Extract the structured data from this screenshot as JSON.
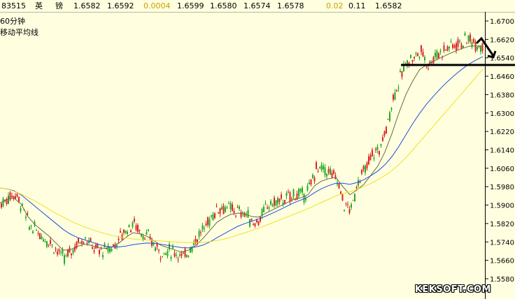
{
  "topbar": {
    "code": "83515",
    "name_1": "英",
    "name_2": "镑",
    "price_1": "1.6582",
    "price_2": "1.6592",
    "change": "0.0004",
    "price_3": "1.6599",
    "price_4": "1.6580",
    "price_5": "1.6574",
    "price_6": "1.6578",
    "pct": "0.02",
    "vol": "0.11",
    "last": "1.6582"
  },
  "labels": {
    "period": "60分钟",
    "indicator": "移动平均线",
    "watermark": "KEKSOFT.COM"
  },
  "colors": {
    "background": "#ffffe0",
    "up_candle": "#22aa22",
    "down_candle": "#dd2222",
    "ma_short": "#6b6b3a",
    "ma_mid": "#1f4fe0",
    "ma_long": "#f0e020",
    "annotation": "#000000"
  },
  "chart_data": {
    "type": "line",
    "y_ticks": [
      "1.6700",
      "1.6620",
      "1.6540",
      "1.6460",
      "1.6380",
      "1.6300",
      "1.6220",
      "1.6140",
      "1.6060",
      "1.5980",
      "1.5900",
      "1.5820",
      "1.5740",
      "1.5660",
      "1.5580"
    ],
    "ylim": [
      1.5545,
      1.6725
    ],
    "x": [
      0,
      10,
      20,
      30,
      40,
      50,
      60,
      70,
      80,
      90,
      100,
      110,
      120,
      130,
      140,
      150,
      160,
      170,
      180,
      190,
      200,
      210,
      220,
      230,
      240,
      250,
      260,
      270,
      280,
      290,
      300,
      310,
      320,
      330,
      340,
      350,
      360,
      370,
      380,
      390,
      400,
      410,
      420,
      430,
      440,
      450,
      460,
      470,
      480,
      490,
      500,
      510,
      520,
      530,
      540,
      550,
      560,
      570,
      580,
      590,
      600,
      610,
      620,
      630,
      640,
      650,
      660,
      670,
      680,
      690
    ],
    "series": [
      {
        "values": [
          1.5905,
          1.5935,
          1.595,
          1.589,
          1.581,
          1.579,
          1.576,
          1.574,
          1.57,
          1.5665,
          1.57,
          1.574,
          1.576,
          1.572,
          1.57,
          1.5705,
          1.572,
          1.5765,
          1.58,
          1.582,
          1.578,
          1.576,
          1.572,
          1.569,
          1.57,
          1.5695,
          1.567,
          1.5715,
          1.576,
          1.58,
          1.585,
          1.589,
          1.589,
          1.588,
          1.587,
          1.586,
          1.582,
          1.584,
          1.59,
          1.591,
          1.592,
          1.593,
          1.595,
          1.594,
          1.597,
          1.606,
          1.6055,
          1.604,
          1.601,
          1.59,
          1.588,
          1.601,
          1.605,
          1.612,
          1.614,
          1.623,
          1.637,
          1.645,
          1.653,
          1.654,
          1.657,
          1.651,
          1.655,
          1.657,
          1.659,
          1.66,
          1.661,
          1.662,
          1.66,
          1.659
        ]
      },
      {
        "values": [
          1.591,
          1.5925,
          1.593,
          1.5905,
          1.585,
          1.5815,
          1.579,
          1.5765,
          1.5735,
          1.5705,
          1.5705,
          1.572,
          1.573,
          1.5725,
          1.5715,
          1.5712,
          1.5718,
          1.5735,
          1.576,
          1.578,
          1.5775,
          1.5765,
          1.5745,
          1.5725,
          1.5715,
          1.5705,
          1.5695,
          1.5705,
          1.5725,
          1.5755,
          1.579,
          1.5825,
          1.5845,
          1.586,
          1.5865,
          1.5862,
          1.585,
          1.5848,
          1.5865,
          1.588,
          1.5895,
          1.591,
          1.5925,
          1.5932,
          1.5945,
          1.5985,
          1.6005,
          1.6015,
          1.602,
          1.598,
          1.5945,
          1.5965,
          1.599,
          1.603,
          1.607,
          1.613,
          1.621,
          1.63,
          1.638,
          1.644,
          1.649,
          1.651,
          1.6525,
          1.654,
          1.6555,
          1.6568,
          1.658,
          1.659,
          1.6592,
          1.659
        ]
      },
      {
        "values": [
          1.5975,
          1.597,
          1.5962,
          1.5945,
          1.592,
          1.5895,
          1.587,
          1.5845,
          1.582,
          1.5795,
          1.5775,
          1.576,
          1.575,
          1.574,
          1.573,
          1.5722,
          1.5718,
          1.5718,
          1.5722,
          1.5728,
          1.5732,
          1.5735,
          1.5734,
          1.573,
          1.5725,
          1.572,
          1.5715,
          1.5714,
          1.5718,
          1.5726,
          1.574,
          1.5758,
          1.5775,
          1.5792,
          1.5808,
          1.582,
          1.583,
          1.584,
          1.5852,
          1.5866,
          1.588,
          1.5895,
          1.591,
          1.5922,
          1.5935,
          1.5955,
          1.5972,
          1.5985,
          1.5995,
          1.5995,
          1.599,
          1.5998,
          1.601,
          1.6028,
          1.6048,
          1.6075,
          1.611,
          1.6155,
          1.6205,
          1.6255,
          1.63,
          1.634,
          1.6375,
          1.6408,
          1.6438,
          1.6465,
          1.649,
          1.6512,
          1.653,
          1.6545
        ]
      },
      {
        "values": [
          1.5975,
          1.597,
          1.596,
          1.5948,
          1.5933,
          1.5918,
          1.59,
          1.5882,
          1.5864,
          1.5848,
          1.5832,
          1.5818,
          1.5806,
          1.5795,
          1.5785,
          1.5776,
          1.5768,
          1.5762,
          1.5757,
          1.5753,
          1.575,
          1.5748,
          1.5746,
          1.5744,
          1.5742,
          1.574,
          1.5738,
          1.5737,
          1.5737,
          1.5738,
          1.5741,
          1.5746,
          1.5752,
          1.576,
          1.577,
          1.578,
          1.579,
          1.58,
          1.5812,
          1.5824,
          1.5836,
          1.5848,
          1.586,
          1.5872,
          1.5884,
          1.5898,
          1.5912,
          1.5926,
          1.594,
          1.595,
          1.5958,
          1.5968,
          1.598,
          1.5994,
          1.601,
          1.6028,
          1.605,
          1.6076,
          1.6106,
          1.614,
          1.6175,
          1.621,
          1.6245,
          1.628,
          1.6315,
          1.635,
          1.6385,
          1.642,
          1.6455,
          1.649
        ]
      }
    ],
    "grid": false
  }
}
